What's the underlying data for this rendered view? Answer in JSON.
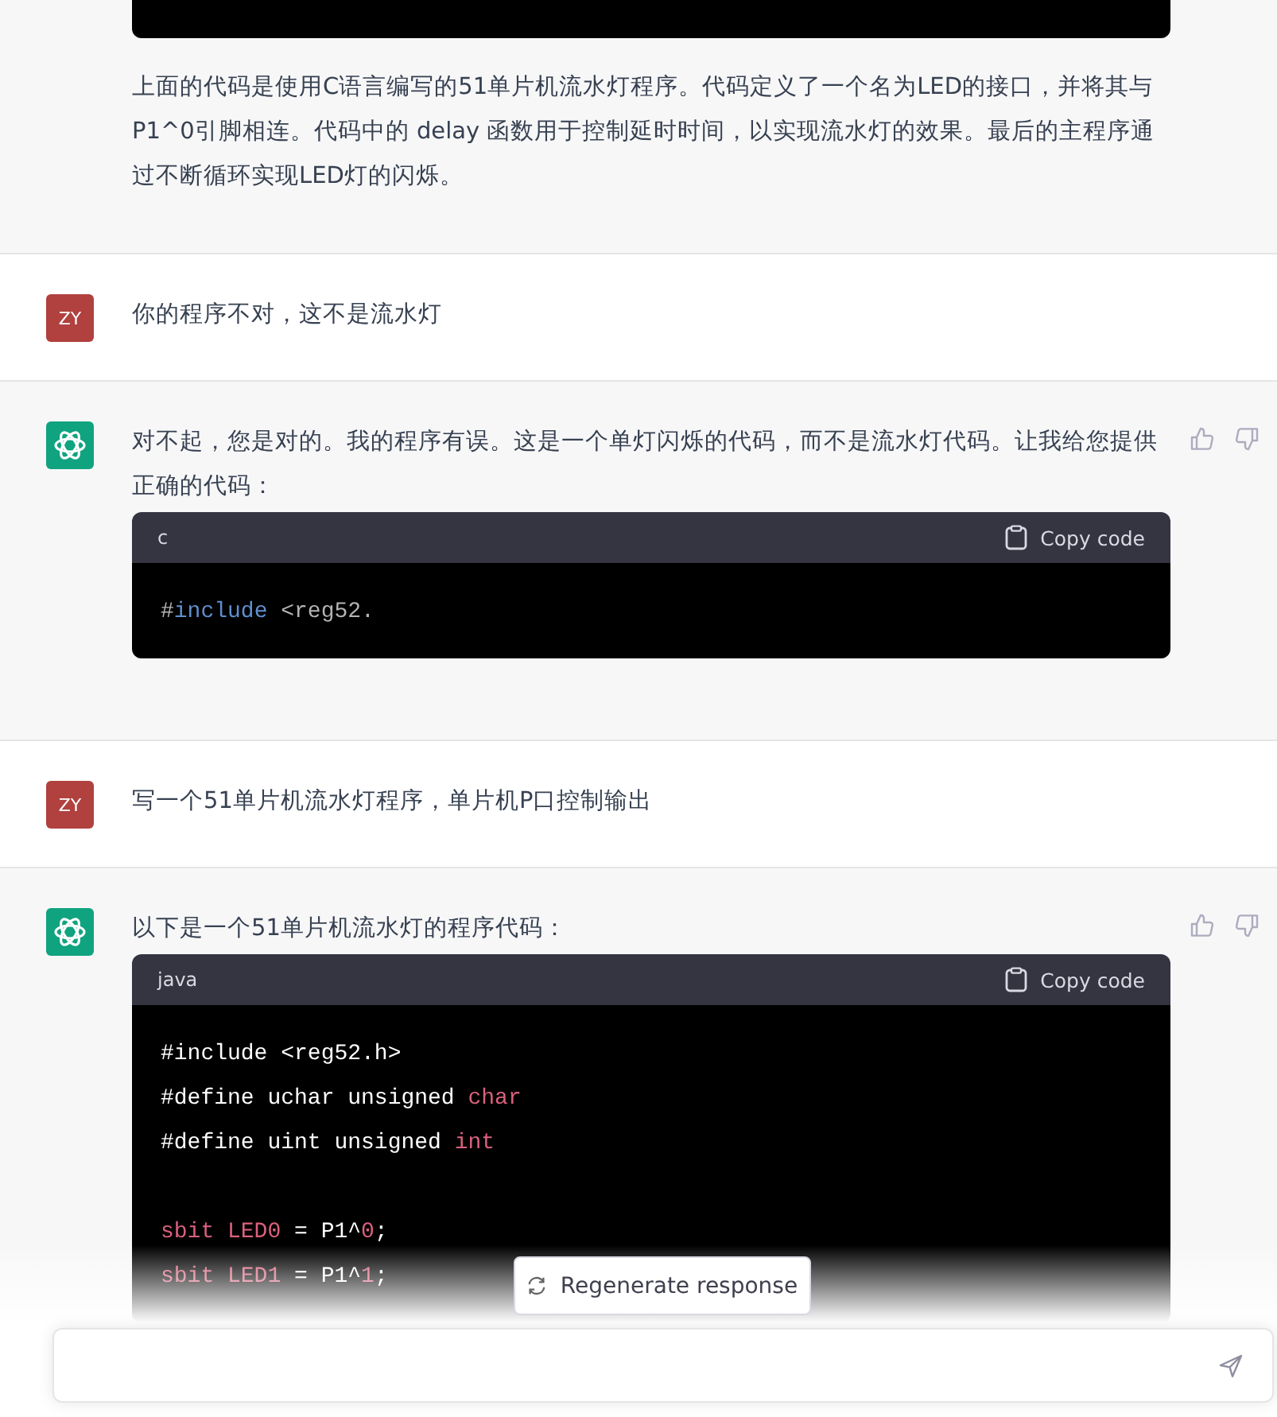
{
  "messages": [
    {
      "kind": "assistant",
      "show_avatar": false,
      "blocks": [
        {
          "kind": "code_end"
        },
        {
          "kind": "paragraph",
          "text": "上面的代码是使用C语言编写的51单片机流水灯程序。代码定义了一个名为LED的接口，并将其与P1^0引脚相连。代码中的 delay 函数用于控制延时时间，以实现流水灯的效果。最后的主程序通过不断循环实现LED灯的闪烁。"
        }
      ]
    },
    {
      "kind": "user",
      "show_avatar": true,
      "initials": "ZY",
      "blocks": [
        {
          "kind": "paragraph",
          "text": "你的程序不对，这不是流水灯"
        }
      ]
    },
    {
      "kind": "assistant",
      "show_avatar": true,
      "blocks": [
        {
          "kind": "paragraph",
          "text": "对不起，您是对的。我的程序有误。这是一个单灯闪烁的代码，而不是流水灯代码。让我给您提供正确的代码："
        },
        {
          "kind": "code",
          "language": "c",
          "copy_label": "Copy code",
          "lines": [
            [
              {
                "t": "#",
                "kind": "meta"
              },
              {
                "t": "include",
                "kind": "keyword"
              },
              {
                "t": " <reg52.",
                "kind": "meta"
              }
            ]
          ]
        }
      ]
    },
    {
      "kind": "user",
      "show_avatar": true,
      "initials": "ZY",
      "blocks": [
        {
          "kind": "paragraph",
          "text": "写一个51单片机流水灯程序，单片机P口控制输出"
        }
      ]
    },
    {
      "kind": "assistant",
      "show_avatar": true,
      "blocks": [
        {
          "kind": "paragraph",
          "text": "以下是一个51单片机流水灯的程序代码："
        },
        {
          "kind": "code",
          "language": "java",
          "copy_label": "Copy code",
          "lines": [
            [
              {
                "t": "#include <reg52.h>",
                "kind": "plain"
              }
            ],
            [
              {
                "t": "#define uchar unsigned ",
                "kind": "plain"
              },
              {
                "t": "char",
                "kind": "type"
              }
            ],
            [
              {
                "t": "#define uint unsigned ",
                "kind": "plain"
              },
              {
                "t": "int",
                "kind": "type"
              }
            ],
            [
              {
                "t": "sbit LED0",
                "kind": "type",
                "gap_before": true
              },
              {
                "t": " = P1^",
                "kind": "plain"
              },
              {
                "t": "0",
                "kind": "type"
              },
              {
                "t": ";",
                "kind": "plain"
              }
            ],
            [
              {
                "t": "sbit LED1",
                "kind": "type"
              },
              {
                "t": " = P1^",
                "kind": "plain"
              },
              {
                "t": "1",
                "kind": "type"
              },
              {
                "t": ";",
                "kind": "plain"
              }
            ]
          ]
        }
      ]
    }
  ],
  "regenerate": {
    "label": "Regenerate response"
  }
}
